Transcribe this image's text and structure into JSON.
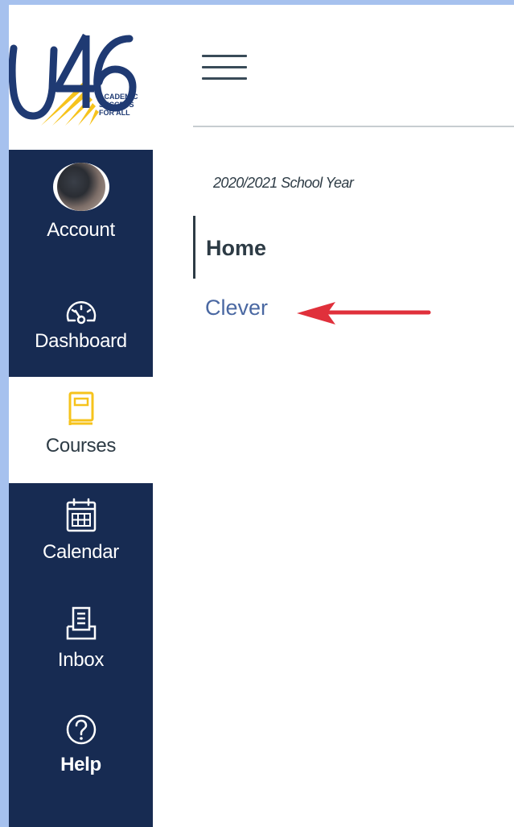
{
  "logo": {
    "mark": "U46",
    "tagline": [
      "ACADEMIC",
      "SUCCESS",
      "FOR ALL"
    ],
    "colors": {
      "primary": "#1f3a73",
      "accent": "#f6c31c"
    }
  },
  "global_nav": {
    "items": [
      {
        "id": "account",
        "label": "Account",
        "icon": "avatar"
      },
      {
        "id": "dashboard",
        "label": "Dashboard",
        "icon": "dashboard-gauge-icon"
      },
      {
        "id": "courses",
        "label": "Courses",
        "icon": "courses-book-icon",
        "active": true
      },
      {
        "id": "calendar",
        "label": "Calendar",
        "icon": "calendar-icon"
      },
      {
        "id": "inbox",
        "label": "Inbox",
        "icon": "inbox-icon"
      },
      {
        "id": "help",
        "label": "Help",
        "icon": "help-question-icon"
      }
    ],
    "colors": {
      "background": "#172b52",
      "text": "#ffffff",
      "active_icon": "#f6c31c"
    }
  },
  "header": {
    "menu_icon": "hamburger-menu-icon"
  },
  "course": {
    "term": "2020/2021 School Year",
    "nav": [
      {
        "label": "Home",
        "active": true
      },
      {
        "label": "Clever"
      }
    ],
    "colors": {
      "link": "#4a68a2",
      "active": "#2d3b45",
      "arrow": "#e0303b"
    }
  }
}
